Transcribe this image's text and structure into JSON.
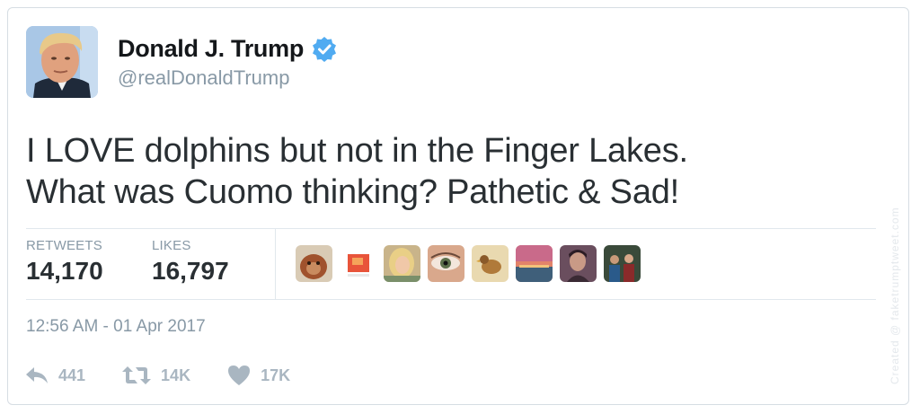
{
  "author": {
    "name": "Donald J. Trump",
    "handle": "@realDonaldTrump",
    "verified_color": "#50abf1"
  },
  "tweet": {
    "line1": "I LOVE dolphins but not in the Finger Lakes.",
    "line2": "What was Cuomo thinking? Pathetic & Sad!"
  },
  "stats": {
    "retweets_label": "RETWEETS",
    "retweets_value": "14,170",
    "likes_label": "LIKES",
    "likes_value": "16,797"
  },
  "likers": [
    {
      "icon": "orangutan-avatar"
    },
    {
      "icon": "red-object-avatar"
    },
    {
      "icon": "blonde-person-avatar"
    },
    {
      "icon": "eye-closeup-avatar"
    },
    {
      "icon": "bird-avatar"
    },
    {
      "icon": "sunset-avatar"
    },
    {
      "icon": "person-portrait-avatar"
    },
    {
      "icon": "group-photo-avatar"
    }
  ],
  "timestamp": "12:56 AM - 01 Apr 2017",
  "actions": {
    "reply_count": "441",
    "retweet_count": "14K",
    "like_count": "17K"
  },
  "watermark": "Created @ faketrumptweet.com"
}
